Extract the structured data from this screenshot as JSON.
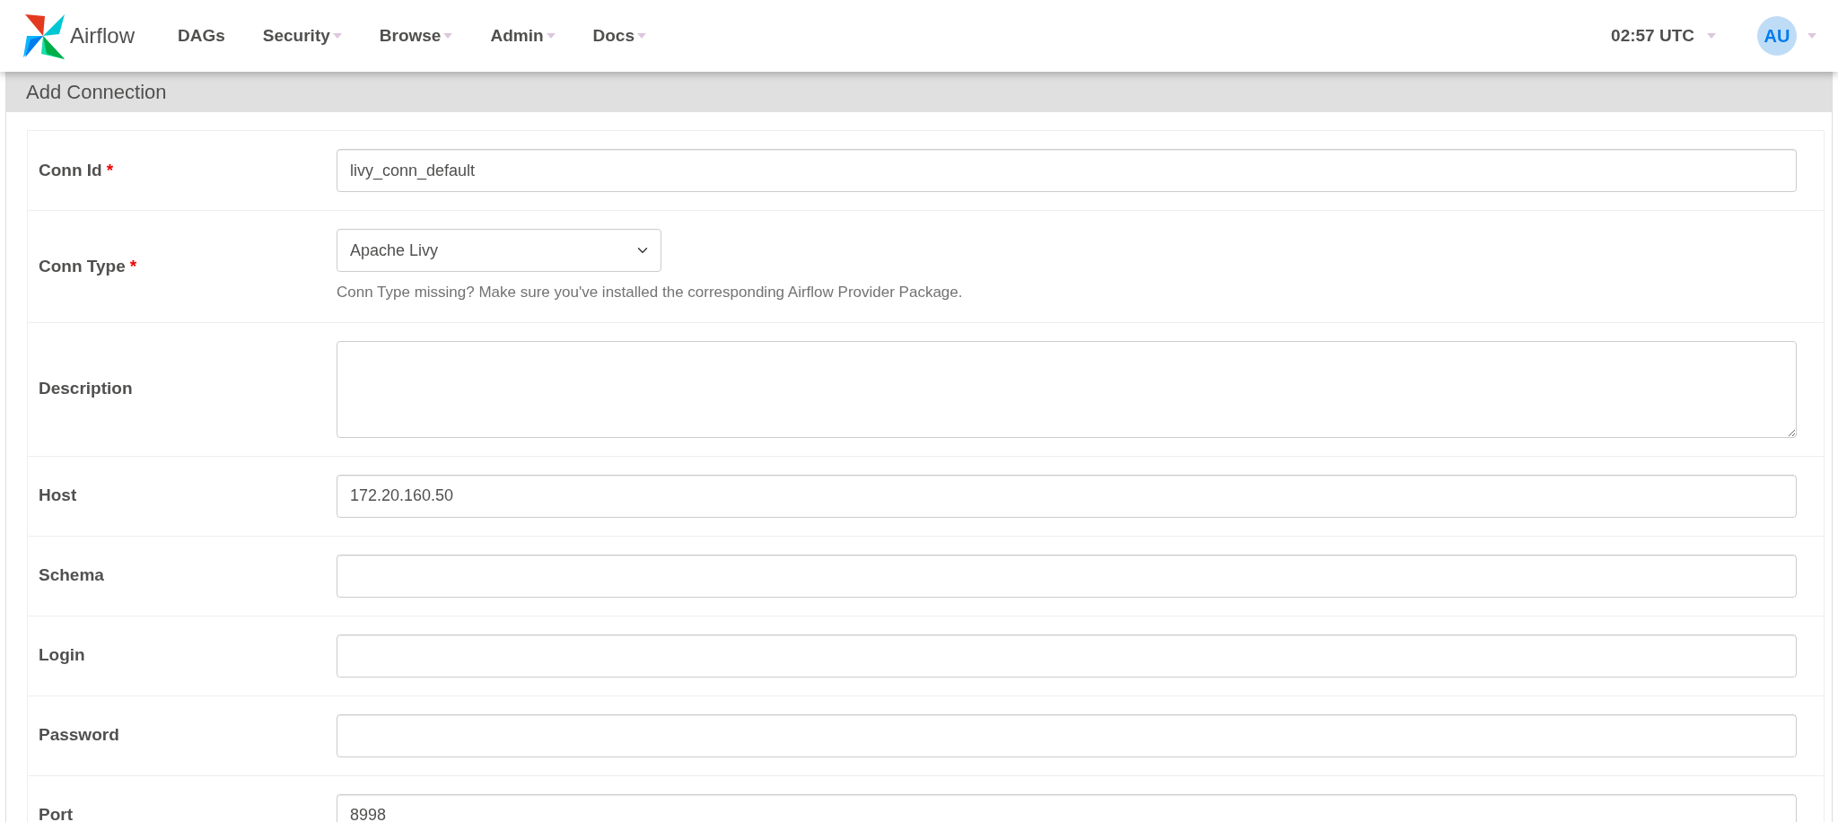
{
  "brand": {
    "name": "Airflow"
  },
  "nav": [
    {
      "label": "DAGs",
      "dropdown": false
    },
    {
      "label": "Security",
      "dropdown": true
    },
    {
      "label": "Browse",
      "dropdown": true
    },
    {
      "label": "Admin",
      "dropdown": true
    },
    {
      "label": "Docs",
      "dropdown": true
    }
  ],
  "clock": {
    "label": "02:57 UTC",
    "dropdown": true
  },
  "user": {
    "initials": "AU",
    "dropdown": true
  },
  "panel": {
    "title": "Add Connection"
  },
  "fields": [
    {
      "label": "Conn Id",
      "required_mark": "*",
      "kind": "input",
      "value": "livy_conn_default"
    },
    {
      "label": "Conn Type",
      "required_mark": "*",
      "kind": "select",
      "value": "Apache Livy",
      "help": "Conn Type missing? Make sure you've installed the corresponding Airflow Provider Package."
    },
    {
      "label": "Description",
      "kind": "textarea"
    },
    {
      "label": "Host",
      "kind": "input",
      "value": "172.20.160.50"
    },
    {
      "label": "Schema",
      "kind": "input"
    },
    {
      "label": "Login",
      "kind": "input"
    },
    {
      "label": "Password",
      "kind": "input"
    },
    {
      "label": "Port",
      "kind": "input",
      "value": "8998"
    }
  ]
}
